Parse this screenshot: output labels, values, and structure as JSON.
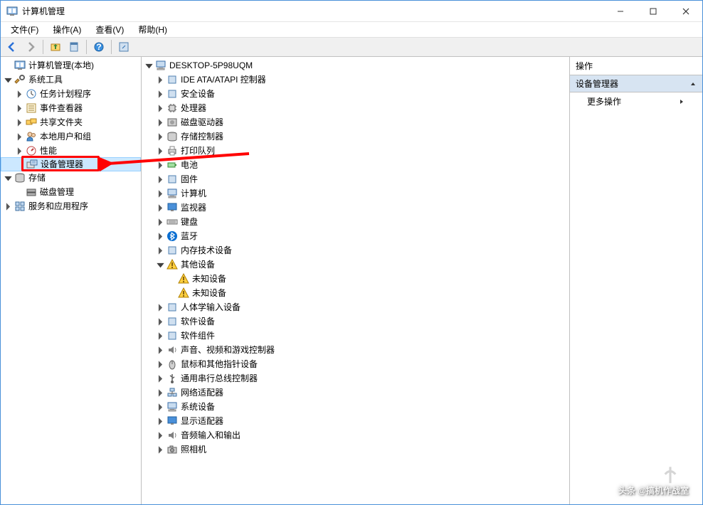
{
  "window": {
    "title": "计算机管理"
  },
  "menubar": [
    {
      "label": "文件(F)"
    },
    {
      "label": "操作(A)"
    },
    {
      "label": "查看(V)"
    },
    {
      "label": "帮助(H)"
    }
  ],
  "toolbar_icons": {
    "back": "back-arrow-icon",
    "forward": "forward-arrow-icon",
    "up": "up-folder-icon",
    "props": "properties-icon",
    "help": "help-icon",
    "refresh": "refresh-icon"
  },
  "left_tree": {
    "root": {
      "label": "计算机管理(本地)"
    },
    "system_tools": {
      "label": "系统工具",
      "children": [
        {
          "label": "任务计划程序"
        },
        {
          "label": "事件查看器"
        },
        {
          "label": "共享文件夹"
        },
        {
          "label": "本地用户和组"
        },
        {
          "label": "性能"
        },
        {
          "label": "设备管理器",
          "selected": true
        }
      ]
    },
    "storage": {
      "label": "存储",
      "children": [
        {
          "label": "磁盘管理"
        }
      ]
    },
    "services": {
      "label": "服务和应用程序"
    }
  },
  "mid_tree": {
    "root": {
      "label": "DESKTOP-5P98UQM"
    },
    "children": [
      {
        "label": "IDE ATA/ATAPI 控制器",
        "icon": "ide-icon"
      },
      {
        "label": "安全设备",
        "icon": "security-icon"
      },
      {
        "label": "处理器",
        "icon": "cpu-icon"
      },
      {
        "label": "磁盘驱动器",
        "icon": "disk-icon"
      },
      {
        "label": "存储控制器",
        "icon": "storage-icon"
      },
      {
        "label": "打印队列",
        "icon": "printer-icon"
      },
      {
        "label": "电池",
        "icon": "battery-icon"
      },
      {
        "label": "固件",
        "icon": "firmware-icon"
      },
      {
        "label": "计算机",
        "icon": "computer-icon"
      },
      {
        "label": "监视器",
        "icon": "monitor-icon"
      },
      {
        "label": "键盘",
        "icon": "keyboard-icon"
      },
      {
        "label": "蓝牙",
        "icon": "bluetooth-icon"
      },
      {
        "label": "内存技术设备",
        "icon": "memory-icon"
      },
      {
        "label": "其他设备",
        "icon": "other-icon",
        "expanded": true,
        "children": [
          {
            "label": "未知设备",
            "icon": "warning-icon"
          },
          {
            "label": "未知设备",
            "icon": "warning-icon"
          }
        ]
      },
      {
        "label": "人体学输入设备",
        "icon": "hid-icon"
      },
      {
        "label": "软件设备",
        "icon": "software-icon"
      },
      {
        "label": "软件组件",
        "icon": "component-icon"
      },
      {
        "label": "声音、视频和游戏控制器",
        "icon": "sound-icon"
      },
      {
        "label": "鼠标和其他指针设备",
        "icon": "mouse-icon"
      },
      {
        "label": "通用串行总线控制器",
        "icon": "usb-icon"
      },
      {
        "label": "网络适配器",
        "icon": "network-icon"
      },
      {
        "label": "系统设备",
        "icon": "system-icon"
      },
      {
        "label": "显示适配器",
        "icon": "display-icon"
      },
      {
        "label": "音频输入和输出",
        "icon": "audio-icon"
      },
      {
        "label": "照相机",
        "icon": "camera-icon"
      }
    ]
  },
  "right": {
    "header": "操作",
    "section": "设备管理器",
    "action": "更多操作"
  },
  "watermark": "头条 @搞机作战室"
}
